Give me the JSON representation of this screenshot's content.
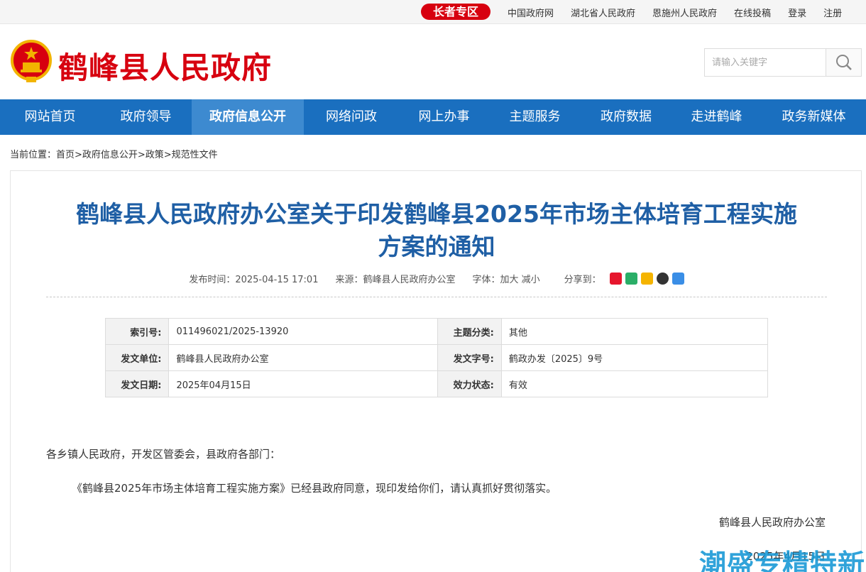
{
  "topbar": {
    "elder_button": "长者专区",
    "links": [
      "中国政府网",
      "湖北省人民政府",
      "恩施州人民政府",
      "在线投稿",
      "登录",
      "注册"
    ]
  },
  "header": {
    "site_title": "鹤峰县人民政府",
    "search_placeholder": "请输入关键字"
  },
  "nav": {
    "items": [
      "网站首页",
      "政府领导",
      "政府信息公开",
      "网络问政",
      "网上办事",
      "主题服务",
      "政府数据",
      "走进鹤峰",
      "政务新媒体"
    ],
    "active_index": 2
  },
  "breadcrumb": "当前位置：首页>政府信息公开>政策>规范性文件",
  "article": {
    "title_line1": "鹤峰县人民政府办公室关于印发鹤峰县2025年市场主体培育工程实施",
    "title_line2": "方案的通知",
    "publish_time": "发布时间：2025-04-15 17:01",
    "source": "来源：鹤峰县人民政府办公室",
    "font_size": "字体：加大 减小",
    "share": "分享到："
  },
  "info": {
    "index_label": "索引号:",
    "index_value": "011496021/2025-13920",
    "topic_label": "主题分类:",
    "topic_value": "其他",
    "issuer_label": "发文单位:",
    "issuer_value": "鹤峰县人民政府办公室",
    "docno_label": "发文字号:",
    "docno_value": "鹤政办发〔2025〕9号",
    "date_label": "发文日期:",
    "date_value": "2025年04月15日",
    "status_label": "效力状态:",
    "status_value": "有效"
  },
  "body": {
    "salutation": "各乡镇人民政府，开发区管委会，县政府各部门：",
    "paragraph1": "《鹤峰县2025年市场主体培育工程实施方案》已经县政府同意，现印发给你们，请认真抓好贯彻落实。",
    "signature": "鹤峰县人民政府办公室",
    "sign_date": "2025年4月15日"
  },
  "watermark": "潮盛专精特新",
  "colors": {
    "brand_red": "#d7000f",
    "nav_blue": "#1a6fbf",
    "title_blue": "#1f5fa5"
  }
}
